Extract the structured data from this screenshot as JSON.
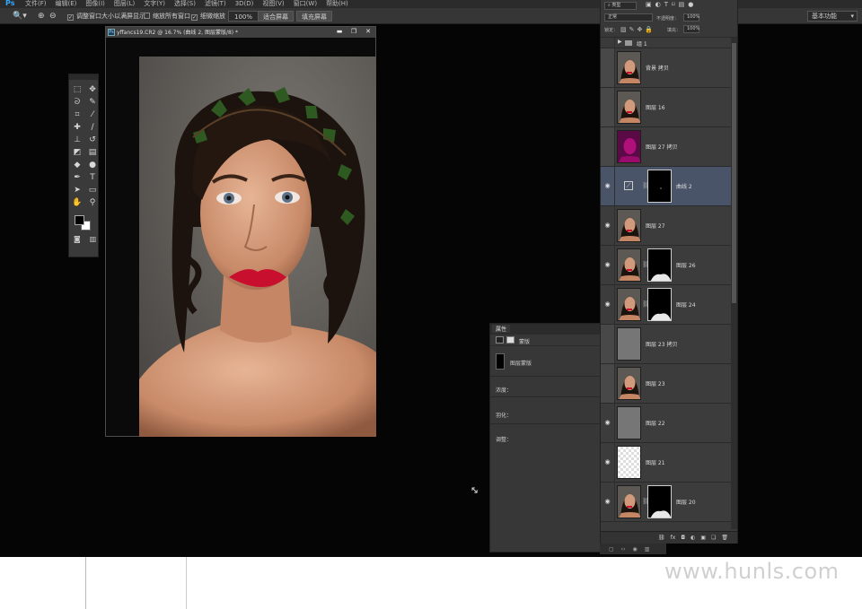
{
  "app": {
    "logo": "Ps",
    "menu": [
      "文件(F)",
      "编辑(E)",
      "图像(I)",
      "图层(L)",
      "文字(Y)",
      "选择(S)",
      "滤镜(T)",
      "3D(D)",
      "视图(V)",
      "窗口(W)",
      "帮助(H)"
    ]
  },
  "options_bar": {
    "resize_windows_label": "调整窗口大小以满屏显示",
    "zoom_all_label": "缩放所有窗口",
    "scrubby_zoom_label": "细微缩放",
    "zoom_value": "100%",
    "fit_screen_label": "适合屏幕",
    "fill_screen_label": "填充屏幕",
    "workspace_label": "基本功能"
  },
  "document": {
    "title": "yffancs19.CR2 @ 16.7% (曲线 2, 图层蒙版/8) *",
    "file_icon": "Ps",
    "minimize": "▬",
    "restore": "❐",
    "close": "✕"
  },
  "properties_panel": {
    "tab_label": "属性",
    "mask_label": "蒙版",
    "layer_mask_label": "图层蒙版",
    "density_label": "浓度：",
    "feather_label": "羽化：",
    "refine_label": "调整："
  },
  "layers_panel": {
    "filter_kind": "类型",
    "blend_mode": "正常",
    "opacity_label": "不透明度：",
    "opacity_value": "100%",
    "lock_label": "锁定：",
    "fill_label": "填充：",
    "fill_value": "100%",
    "group_name": "组 1",
    "layers": [
      {
        "name": "背景 拷贝",
        "visible": false,
        "thumb": "photo",
        "mask": false,
        "selected": false
      },
      {
        "name": "图层 16",
        "visible": false,
        "thumb": "photo",
        "mask": false,
        "selected": false
      },
      {
        "name": "图层 27 拷贝",
        "visible": false,
        "thumb": "magenta",
        "mask": false,
        "selected": false
      },
      {
        "name": "曲线 2",
        "visible": true,
        "thumb": "curves",
        "mask": true,
        "selected": true
      },
      {
        "name": "图层 27",
        "visible": true,
        "thumb": "photo",
        "mask": false,
        "selected": false
      },
      {
        "name": "图层 26",
        "visible": true,
        "thumb": "photo",
        "mask": true,
        "selected": false
      },
      {
        "name": "图层 24",
        "visible": true,
        "thumb": "photo",
        "mask": true,
        "selected": false
      },
      {
        "name": "图层 23 拷贝",
        "visible": false,
        "thumb": "gray",
        "mask": false,
        "selected": false
      },
      {
        "name": "图层 23",
        "visible": false,
        "thumb": "photo",
        "mask": false,
        "selected": false
      },
      {
        "name": "图层 22",
        "visible": true,
        "thumb": "gray",
        "mask": false,
        "selected": false
      },
      {
        "name": "图层 21",
        "visible": true,
        "thumb": "transparent",
        "mask": false,
        "selected": false
      },
      {
        "name": "图层 20",
        "visible": true,
        "thumb": "photo",
        "mask": true,
        "selected": false
      }
    ],
    "footer_icons": [
      "link-icon",
      "fx-icon",
      "mask-icon",
      "adjustment-icon",
      "folder-icon",
      "new-layer-icon",
      "trash-icon"
    ],
    "footer_labels": [
      "⛓",
      "fx",
      "◘",
      "◐",
      "▣",
      "❏",
      "🗑"
    ]
  },
  "watermark": "www.hunls.com",
  "colors": {
    "selected_layer": "#4a5468",
    "panel_bg": "#3a3a3a",
    "lip_red": "#c8102e",
    "magenta_layer": "#b0107a"
  }
}
